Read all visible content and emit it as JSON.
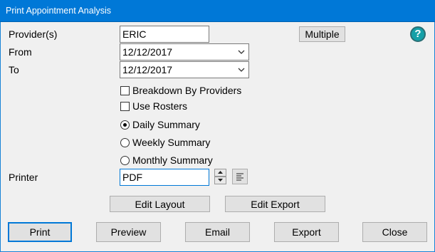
{
  "window": {
    "title": "Print Appointment Analysis"
  },
  "form": {
    "provider_label": "Provider(s)",
    "provider_value": "ERIC",
    "multiple_label": "Multiple",
    "from_label": "From",
    "from_value": "12/12/2017",
    "to_label": "To",
    "to_value": "12/12/2017",
    "breakdown_label": "Breakdown By Providers",
    "use_rosters_label": "Use Rosters",
    "summary_options": [
      "Daily Summary",
      "Weekly Summary",
      "Monthly Summary"
    ],
    "selected_summary": "Daily Summary",
    "printer_label": "Printer",
    "printer_value": "PDF"
  },
  "layout_buttons": {
    "edit_layout": "Edit Layout",
    "edit_export": "Edit Export"
  },
  "footer": {
    "print": "Print",
    "preview": "Preview",
    "email": "Email",
    "export": "Export",
    "close": "Close"
  },
  "icons": {
    "help": "?"
  },
  "colors": {
    "titlebar": "#0078d7",
    "help_icon": "#15a0a8"
  }
}
